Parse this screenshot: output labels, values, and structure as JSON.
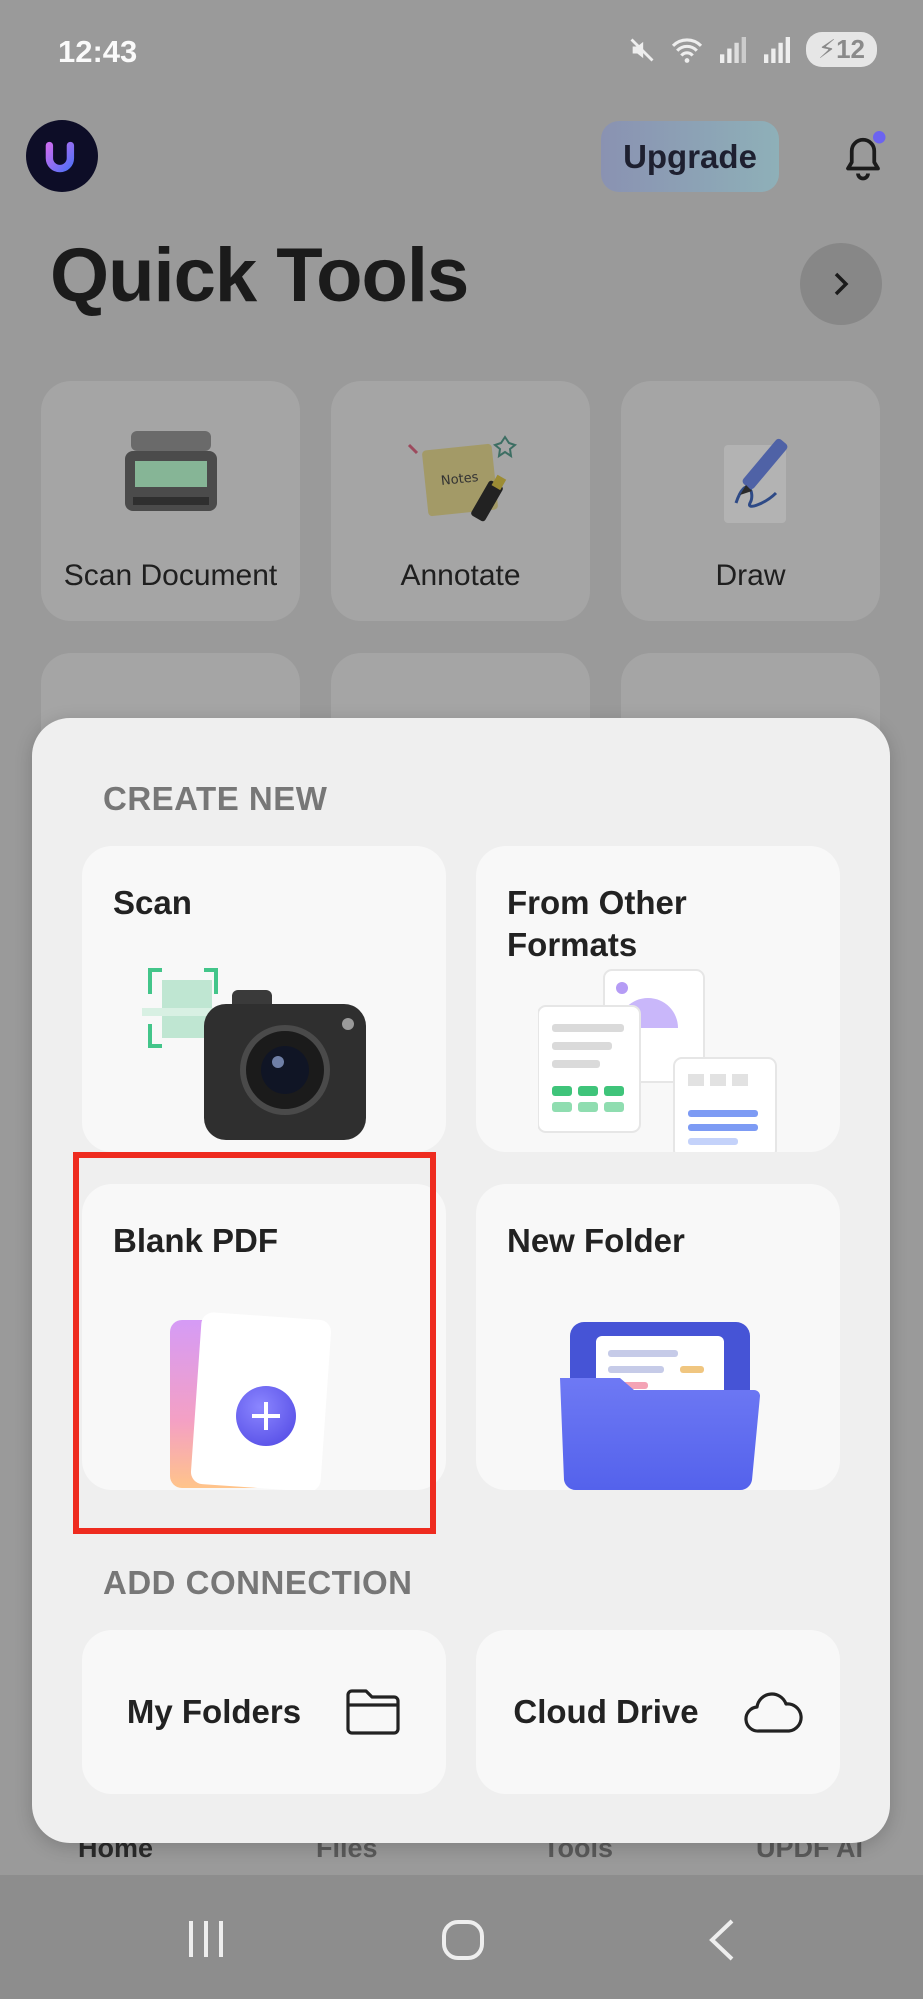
{
  "status_bar": {
    "time": "12:43",
    "battery": "12"
  },
  "header": {
    "upgrade_label": "Upgrade"
  },
  "quick_tools": {
    "title": "Quick Tools",
    "tools": [
      {
        "label": "Scan Document",
        "icon": "scanner-icon"
      },
      {
        "label": "Annotate",
        "icon": "notes-icon"
      },
      {
        "label": "Draw",
        "icon": "draw-icon"
      }
    ]
  },
  "bottom_nav": {
    "items": [
      "Home",
      "Files",
      "Tools",
      "UPDF AI"
    ]
  },
  "create_new": {
    "title": "CREATE NEW",
    "items": [
      {
        "label": "Scan",
        "icon": "camera-icon"
      },
      {
        "label": "From Other Formats",
        "icon": "documents-icon"
      },
      {
        "label": "Blank PDF",
        "icon": "blank-pdf-icon"
      },
      {
        "label": "New Folder",
        "icon": "folder-icon"
      }
    ]
  },
  "add_connection": {
    "title": "ADD CONNECTION",
    "items": [
      {
        "label": "My Folders",
        "icon": "folder-outline-icon"
      },
      {
        "label": "Cloud Drive",
        "icon": "cloud-icon"
      }
    ]
  },
  "colors": {
    "accent": "#6c63f0",
    "highlight": "#ee2b1f"
  }
}
